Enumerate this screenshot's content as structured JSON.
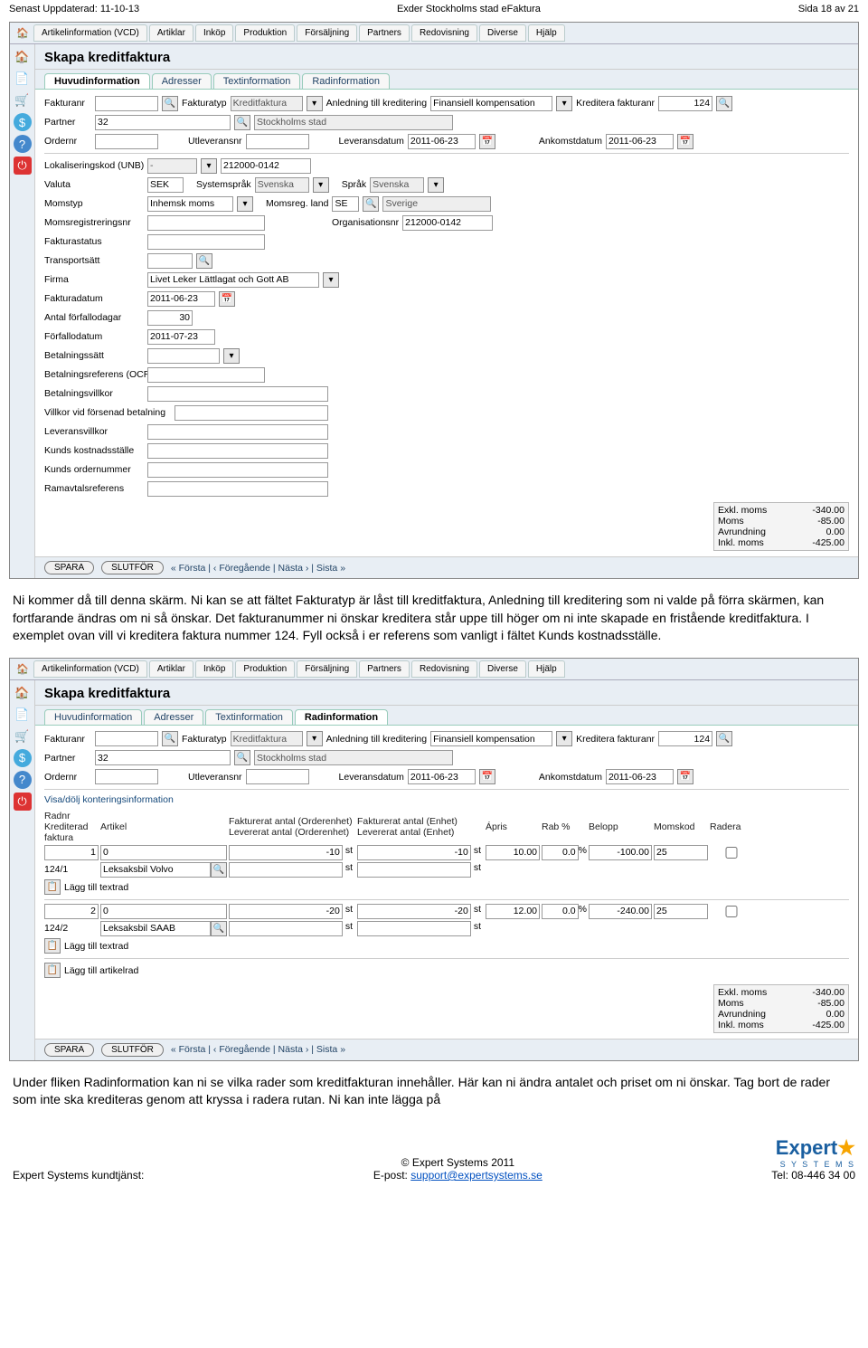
{
  "header": {
    "left": "Senast Uppdaterad: 11-10-13",
    "center": "Exder Stockholms stad eFaktura",
    "right": "Sida 18 av 21"
  },
  "menu": {
    "items": [
      "Artikelinformation (VCD)",
      "Artiklar",
      "Inköp",
      "Produktion",
      "Försäljning",
      "Partners",
      "Redovisning",
      "Diverse",
      "Hjälp"
    ]
  },
  "sidebar_icons": [
    "home",
    "doc",
    "tag",
    "dollar",
    "question",
    "power"
  ],
  "screen1": {
    "title": "Skapa kreditfaktura",
    "tabs": [
      "Huvudinformation",
      "Adresser",
      "Textinformation",
      "Radinformation"
    ],
    "active_tab": 0,
    "row1": {
      "lbl_fakturanr": "Fakturanr",
      "fakturanr": "",
      "lbl_fakturatyp": "Fakturatyp",
      "fakturatyp": "Kreditfaktura",
      "lbl_anledning": "Anledning till kreditering",
      "anledning": "Finansiell kompensation",
      "lbl_kredfaknr": "Kreditera fakturanr",
      "kredfaknr": "124"
    },
    "row2": {
      "lbl_partner": "Partner",
      "partner": "32",
      "partner_name": "Stockholms stad"
    },
    "row3": {
      "lbl_ordernr": "Ordernr",
      "ordernr": "",
      "lbl_utlev": "Utleveransnr",
      "utlev": "",
      "lbl_levdat": "Leveransdatum",
      "levdat": "2011-06-23",
      "lbl_ankdat": "Ankomstdatum",
      "ankdat": "2011-06-23"
    },
    "row4": {
      "lbl": "Lokaliseringskod (UNB)",
      "sel": "-",
      "val": "212000-0142"
    },
    "row5": {
      "lbl": "Valuta",
      "valuta": "SEK",
      "lbl2": "Systemspråk",
      "syslang": "Svenska",
      "lbl3": "Språk",
      "lang": "Svenska"
    },
    "row6": {
      "lbl": "Momstyp",
      "momstyp": "Inhemsk moms",
      "lbl2": "Momsreg. land",
      "land": "SE",
      "landname": "Sverige"
    },
    "row7": {
      "lbl": "Momsregistreringsnr",
      "val": "",
      "lbl2": "Organisationsnr",
      "org": "212000-0142"
    },
    "labels": {
      "fakturastatus": "Fakturastatus",
      "transportsatt": "Transportsätt",
      "firma": "Firma",
      "fakturadatum": "Fakturadatum",
      "antal_forf": "Antal förfallodagar",
      "forfallo": "Förfallodatum",
      "betsatt": "Betalningssätt",
      "ocr": "Betalningsreferens (OCR)",
      "betvillkor": "Betalningsvillkor",
      "villkor_sen": "Villkor vid försenad betalning",
      "levvillkor": "Leveransvillkor",
      "kostnad": "Kunds kostnadsställe",
      "kundorder": "Kunds ordernummer",
      "ramavtal": "Ramavtalsreferens"
    },
    "values": {
      "firma": "Livet Leker Lättlagat och Gott AB",
      "fakturadatum": "2011-06-23",
      "antal_forf": "30",
      "forfallo": "2011-07-23"
    }
  },
  "totals": {
    "exkl_lbl": "Exkl. moms",
    "exkl": "-340.00",
    "moms_lbl": "Moms",
    "moms": "-85.00",
    "avr_lbl": "Avrundning",
    "avr": "0.00",
    "inkl_lbl": "Inkl. moms",
    "inkl": "-425.00"
  },
  "footer_buttons": {
    "spara": "SPARA",
    "slutfor": "SLUTFÖR"
  },
  "nav": "« Första  |  ‹ Föregående  |  Nästa ›  |  Sista »",
  "paragraph1": "Ni kommer då till denna skärm. Ni kan se att fältet Fakturatyp är låst till kreditfaktura, Anledning till kreditering som ni valde på förra skärmen, kan fortfarande ändras om ni så önskar. Det fakturanummer ni önskar kreditera står uppe till höger om ni inte skapade en fristående kreditfaktura. I exemplet ovan vill vi kreditera faktura nummer 124. Fyll också i er referens som vanligt i fältet Kunds kostnadsställe.",
  "screen2": {
    "active_tab": 3,
    "link_visa": "Visa/dölj konteringsinformation",
    "headers": {
      "radnr": "Radnr",
      "kred": "Krediterad faktura",
      "artikel": "Artikel",
      "fakt_order": "Fakturerat antal (Orderenhet)",
      "lev_order": "Levererat antal (Orderenhet)",
      "fakt_enh": "Fakturerat antal (Enhet)",
      "lev_enh": "Levererat antal (Enhet)",
      "apris": "Ápris",
      "rab": "Rab %",
      "belopp": "Belopp",
      "momskod": "Momskod",
      "radera": "Radera"
    },
    "rows": [
      {
        "radnr": "1",
        "kred": "124/1",
        "artikelnr": "0",
        "artikelname": "Leksaksbil Volvo",
        "fakt_order": "-10",
        "enh1": "st",
        "fakt_enh": "-10",
        "enh2": "st",
        "apris": "10.00",
        "rab": "0.0",
        "pct": "%",
        "belopp": "-100.00",
        "momskod": "25"
      },
      {
        "radnr": "2",
        "kred": "124/2",
        "artikelnr": "0",
        "artikelname": "Leksaksbil SAAB",
        "fakt_order": "-20",
        "enh1": "st",
        "fakt_enh": "-20",
        "enh2": "st",
        "apris": "12.00",
        "rab": "0.0",
        "pct": "%",
        "belopp": "-240.00",
        "momskod": "25"
      }
    ],
    "add_textrad": "Lägg till textrad",
    "add_artikelrad": "Lägg till artikelrad"
  },
  "paragraph2": "Under fliken Radinformation kan ni se vilka rader som kreditfakturan innehåller. Här kan ni ändra antalet och priset om ni önskar. Tag bort de rader som inte ska krediteras genom att kryssa i radera rutan. Ni kan inte lägga på",
  "footer": {
    "left": "Expert Systems kundtjänst:",
    "center_copy": "© Expert Systems 2011",
    "center_email_lbl": "E-post: ",
    "center_email": "support@expertsystems.se",
    "right": "Tel: 08-446 34 00",
    "logo": "Expert",
    "logo_sub": "S Y S T E M S"
  }
}
